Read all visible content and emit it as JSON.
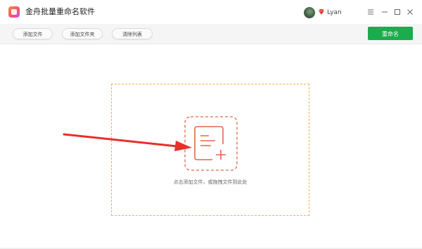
{
  "window": {
    "title": "金舟批量重命名软件",
    "username": "Lyan"
  },
  "toolbar": {
    "add_files": "添加文件",
    "add_folder": "添加文件夹",
    "clear_list": "清除列表",
    "rename": "重命名"
  },
  "dropzone": {
    "hint": "点击添加文件，或拖拽文件到此处"
  },
  "icons": {
    "logo": "app-logo-icon",
    "vip": "vip-diamond-icon",
    "add_file": "add-file-icon",
    "minimize": "minimize-icon",
    "maximize": "maximize-icon",
    "close": "close-icon",
    "menu": "menu-icon"
  },
  "colors": {
    "primary": "#1aac4d",
    "accent": "#e0674f",
    "dropzone_border": "#f0b04a",
    "arrow": "#e8302a"
  }
}
